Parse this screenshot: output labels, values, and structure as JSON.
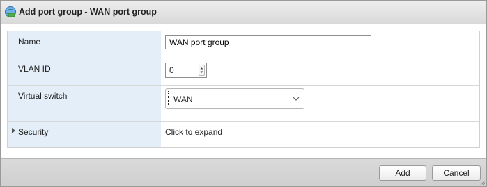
{
  "dialog": {
    "title": "Add port group - WAN port group"
  },
  "form": {
    "name": {
      "label": "Name",
      "value": "WAN port group"
    },
    "vlan_id": {
      "label": "VLAN ID",
      "value": "0"
    },
    "virtual_switch": {
      "label": "Virtual switch",
      "value": "WAN"
    },
    "security": {
      "label": "Security",
      "expand_text": "Click to expand"
    }
  },
  "footer": {
    "add_label": "Add",
    "cancel_label": "Cancel"
  },
  "colors": {
    "label_background": "#e3eef8",
    "title_gradient_top": "#eeeeee",
    "footer_background": "#d5d5d5"
  }
}
